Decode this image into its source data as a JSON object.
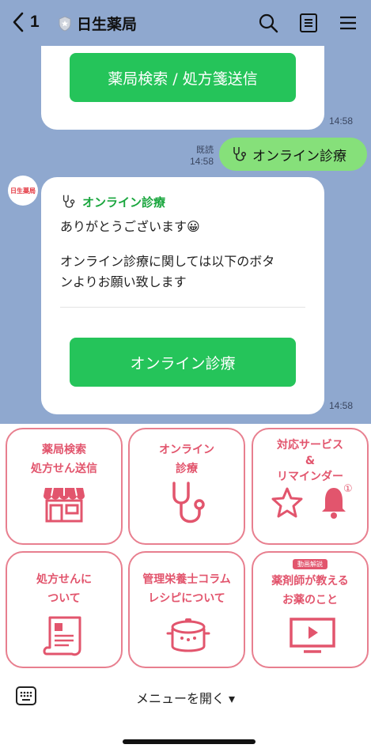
{
  "header": {
    "back_count": "1",
    "title": "日生薬局"
  },
  "chat": {
    "top_card": {
      "button_label": "薬局検索 / 処方箋送信",
      "time": "14:58"
    },
    "sent_message": {
      "read_label": "既読",
      "time": "14:58",
      "text": "オンライン診療"
    },
    "reply": {
      "avatar_text": "日生薬局",
      "heading": "オンライン診療",
      "line1": "ありがとうございます😀",
      "line2": "オンライン診療に関しては以下のボタ",
      "line3": "ンよりお願い致します",
      "button_label": "オンライン診療",
      "time": "14:58"
    }
  },
  "rich_menu": {
    "tiles": [
      {
        "line1": "薬局検索",
        "line2": "処方せん送信",
        "icon": "shop-icon"
      },
      {
        "line1": "オンライン",
        "line2": "診療",
        "icon": "stethoscope-icon"
      },
      {
        "line1": "対応サービス",
        "line2": "&",
        "line3": "リマインダー",
        "icon": "star-bell-icon",
        "badge": "①"
      },
      {
        "line1": "処方せんに",
        "line2": "ついて",
        "icon": "prescription-scroll-icon"
      },
      {
        "line1": "管理栄養士コラム",
        "line2": "レシピについて",
        "icon": "cooking-pot-icon"
      },
      {
        "tag": "動画解説",
        "line1": "薬剤師が教える",
        "line2": "お薬のこと",
        "icon": "video-player-icon"
      }
    ]
  },
  "bottom_bar": {
    "open_menu_label": "メニューを開く ▾"
  },
  "colors": {
    "chat_bg": "#8fa8cf",
    "line_green": "#25c45a",
    "sent_bubble": "#86e07a",
    "menu_pink": "#e2556d"
  }
}
